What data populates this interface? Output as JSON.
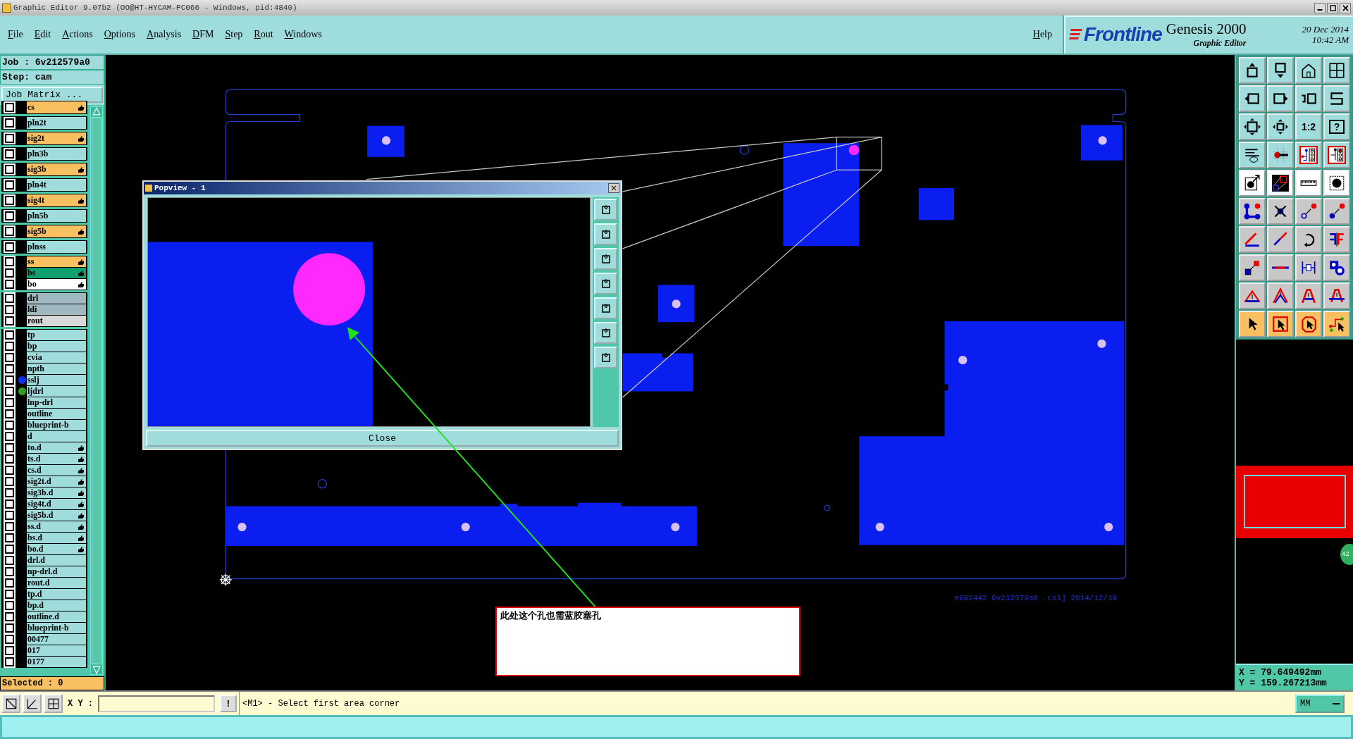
{
  "window": {
    "title": "Graphic Editor 9.07b2 (OO@HT-HYCAM-PC066 - Windows, pid:4840)"
  },
  "menu": [
    "File",
    "Edit",
    "Actions",
    "Options",
    "Analysis",
    "DFM",
    "Step",
    "Rout",
    "Windows"
  ],
  "help": "Help",
  "brand": {
    "logo": "Frontline",
    "product": "Genesis 2000",
    "subtitle": "Graphic Editor",
    "date": "20 Dec 2014",
    "time": "10:42 AM"
  },
  "job": {
    "job": "Job : 6v212579a0",
    "step": "Step: cam",
    "matrix_button": "Job Matrix ..."
  },
  "layer_groups": [
    {
      "layers": [
        {
          "name": "cs",
          "color": "#f8c060",
          "checked": false,
          "editable": true
        }
      ]
    },
    {
      "layers": [
        {
          "name": "pln2t",
          "color": "#a0dcdc",
          "checked": false,
          "editable": false
        }
      ]
    },
    {
      "layers": [
        {
          "name": "sig2t",
          "color": "#f8c060",
          "checked": false,
          "editable": true
        }
      ]
    },
    {
      "layers": [
        {
          "name": "pln3b",
          "color": "#a0dcdc",
          "checked": false,
          "editable": false
        }
      ]
    },
    {
      "layers": [
        {
          "name": "sig3b",
          "color": "#f8c060",
          "checked": false,
          "editable": true
        }
      ]
    },
    {
      "layers": [
        {
          "name": "pln4t",
          "color": "#a0dcdc",
          "checked": false,
          "editable": false
        }
      ]
    },
    {
      "layers": [
        {
          "name": "sig4t",
          "color": "#f8c060",
          "checked": false,
          "editable": true
        }
      ]
    },
    {
      "layers": [
        {
          "name": "pln5b",
          "color": "#a0dcdc",
          "checked": false,
          "editable": false
        }
      ]
    },
    {
      "layers": [
        {
          "name": "sig5b",
          "color": "#f8c060",
          "checked": false,
          "editable": true
        }
      ]
    },
    {
      "layers": [
        {
          "name": "plnss",
          "color": "#a0dcdc",
          "checked": false,
          "editable": false
        }
      ]
    },
    {
      "layers": [
        {
          "name": "ss",
          "color": "#f8c060",
          "checked": false,
          "editable": true
        },
        {
          "name": "bs",
          "color": "#10a070",
          "checked": false,
          "editable": true
        },
        {
          "name": "bo",
          "color": "#ffffff",
          "checked": false,
          "editable": true
        }
      ]
    },
    {
      "layers": [
        {
          "name": "drl",
          "color": "#a0b8c0",
          "checked": false,
          "editable": false
        },
        {
          "name": "ldi",
          "color": "#a0b8c0",
          "checked": false,
          "editable": false
        },
        {
          "name": "rout",
          "color": "#d8d8d8",
          "checked": false,
          "editable": false
        }
      ]
    },
    {
      "layers": [
        {
          "name": "tp",
          "color": "#a0dcdc",
          "checked": false,
          "editable": false
        },
        {
          "name": "bp",
          "color": "#a0dcdc",
          "checked": false,
          "editable": false
        },
        {
          "name": "cvia",
          "color": "#a0dcdc",
          "checked": false,
          "editable": false
        },
        {
          "name": "npth",
          "color": "#a0dcdc",
          "checked": false,
          "editable": false
        },
        {
          "name": "sslj",
          "color": "#a0dcdc",
          "checked": false,
          "editable": false,
          "dot": {
            "color": "#1030f0"
          }
        },
        {
          "name": "ljdrl",
          "color": "#a0dcdc",
          "checked": false,
          "editable": false,
          "dot": {
            "color": "#30a020"
          }
        },
        {
          "name": "lnp-drl",
          "color": "#a0dcdc",
          "checked": false,
          "editable": false
        },
        {
          "name": "outline",
          "color": "#a0dcdc",
          "checked": false,
          "editable": false
        },
        {
          "name": "blueprint-b",
          "color": "#a0dcdc",
          "checked": false,
          "editable": false
        },
        {
          "name": "d",
          "color": "#a0dcdc",
          "checked": false,
          "editable": false
        },
        {
          "name": "to.d",
          "color": "#a0dcdc",
          "checked": false,
          "editable": true
        },
        {
          "name": "ts.d",
          "color": "#a0dcdc",
          "checked": false,
          "editable": true
        },
        {
          "name": "cs.d",
          "color": "#a0dcdc",
          "checked": false,
          "editable": true
        },
        {
          "name": "sig2t.d",
          "color": "#a0dcdc",
          "checked": false,
          "editable": true
        },
        {
          "name": "sig3b.d",
          "color": "#a0dcdc",
          "checked": false,
          "editable": true
        },
        {
          "name": "sig4t.d",
          "color": "#a0dcdc",
          "checked": false,
          "editable": true
        },
        {
          "name": "sig5b.d",
          "color": "#a0dcdc",
          "checked": false,
          "editable": true
        },
        {
          "name": "ss.d",
          "color": "#a0dcdc",
          "checked": false,
          "editable": true
        },
        {
          "name": "bs.d",
          "color": "#a0dcdc",
          "checked": false,
          "editable": true
        },
        {
          "name": "bo.d",
          "color": "#a0dcdc",
          "checked": false,
          "editable": true
        },
        {
          "name": "drl.d",
          "color": "#a0dcdc",
          "checked": false,
          "editable": false
        },
        {
          "name": "np-drl.d",
          "color": "#a0dcdc",
          "checked": false,
          "editable": false
        },
        {
          "name": "rout.d",
          "color": "#a0dcdc",
          "checked": false,
          "editable": false
        },
        {
          "name": "tp.d",
          "color": "#a0dcdc",
          "checked": false,
          "editable": false
        },
        {
          "name": "bp.d",
          "color": "#a0dcdc",
          "checked": false,
          "editable": false
        },
        {
          "name": "outline.d",
          "color": "#a0dcdc",
          "checked": false,
          "editable": false
        },
        {
          "name": "blueprint-b",
          "color": "#a0dcdc",
          "checked": false,
          "editable": false
        },
        {
          "name": "00477",
          "color": "#a0dcdc",
          "checked": false,
          "editable": false
        },
        {
          "name": "017",
          "color": "#a0dcdc",
          "checked": false,
          "editable": false
        },
        {
          "name": "0177",
          "color": "#a0dcdc",
          "checked": false,
          "editable": false
        }
      ]
    }
  ],
  "selected_count": "Selected : 0",
  "canvas": {
    "board_text": "e682442 6v212579a0 .cs1] 2014/12/19",
    "note": "此处这个孔也需蓝胶塞孔"
  },
  "popview": {
    "title": "Popview - 1",
    "close_glyph": "×",
    "close_button": "Close"
  },
  "toolbar": {
    "zoom_ratio": "1:2",
    "help": "?"
  },
  "side_badge": "42",
  "coordinates": {
    "x": "X = 79.649492mm",
    "y": "Y = 159.267213mm"
  },
  "command_bar": {
    "xy_label": "X Y :",
    "bang": "!",
    "message": "<M1> - Select first area corner",
    "units": "MM"
  }
}
